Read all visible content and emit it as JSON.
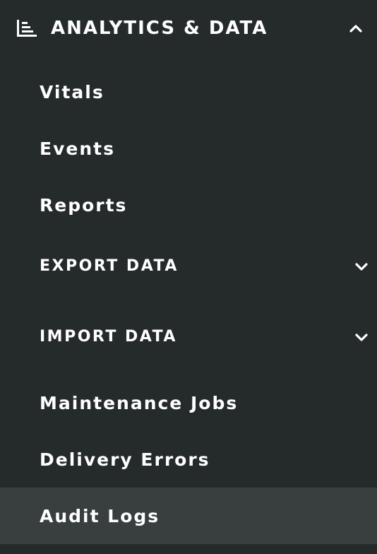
{
  "section": {
    "title": "ANALYTICS & DATA",
    "icon": "bar-chart-icon",
    "expanded": true,
    "toggle_icon": "chevron-up-icon"
  },
  "items": [
    {
      "label": "Vitals",
      "type": "link",
      "active": false
    },
    {
      "label": "Events",
      "type": "link",
      "active": false
    },
    {
      "label": "Reports",
      "type": "link",
      "active": false
    },
    {
      "label": "EXPORT DATA",
      "type": "group",
      "expanded": false,
      "icon": "chevron-down-icon"
    },
    {
      "label": "IMPORT DATA",
      "type": "group",
      "expanded": false,
      "icon": "chevron-down-icon"
    },
    {
      "label": "Maintenance Jobs",
      "type": "link",
      "active": false
    },
    {
      "label": "Delivery Errors",
      "type": "link",
      "active": false
    },
    {
      "label": "Audit Logs",
      "type": "link",
      "active": true
    }
  ],
  "colors": {
    "background": "#252b2b",
    "active_background": "#383f3e",
    "text": "#ffffff"
  }
}
